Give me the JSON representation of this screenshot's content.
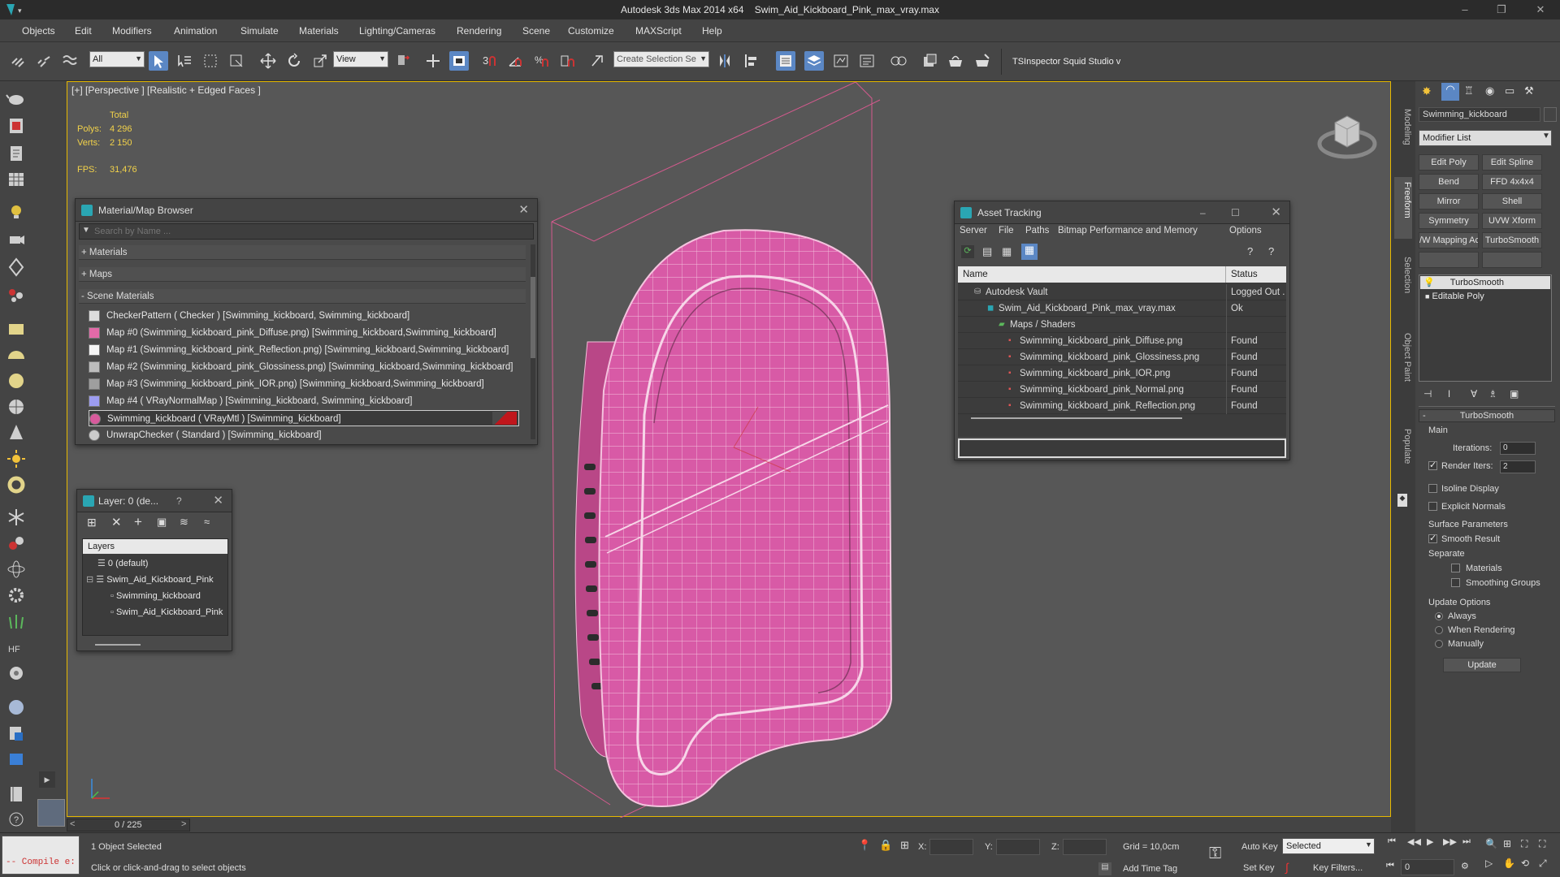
{
  "titlebar": {
    "app": "Autodesk 3ds Max  2014 x64",
    "file": "Swim_Aid_Kickboard_Pink_max_vray.max"
  },
  "menubar": {
    "items": [
      "Objects",
      "Edit",
      "Modifiers",
      "Animation",
      "Simulate",
      "Materials",
      "Lighting/Cameras",
      "Rendering",
      "Scene",
      "Customize",
      "MAXScript",
      "Help"
    ]
  },
  "toolbar": {
    "filter_value": "All",
    "ref_coord_value": "View",
    "selection_set_placeholder": "Create Selection Se",
    "ext_tools": "TSInspector  Squid Studio v"
  },
  "viewport": {
    "label": "[+] [Perspective ] [Realistic + Edged Faces ]",
    "stats_header": "Total",
    "polys_label": "Polys:",
    "polys_value": "4 296",
    "verts_label": "Verts:",
    "verts_value": "2 150",
    "fps_label": "FPS:",
    "fps_value": "31,476"
  },
  "material_browser": {
    "title": "Material/Map Browser",
    "search_placeholder": "Search by Name ...",
    "sections": [
      "+ Materials",
      "+ Maps",
      "- Scene Materials"
    ],
    "items": [
      {
        "label": "CheckerPattern  ( Checker ) [Swimming_kickboard, Swimming_kickboard]",
        "color": "#dddddd"
      },
      {
        "label": "Map #0 (Swimming_kickboard_pink_Diffuse.png) [Swimming_kickboard,Swimming_kickboard]",
        "color": "#e26aa8"
      },
      {
        "label": "Map #1 (Swimming_kickboard_pink_Reflection.png) [Swimming_kickboard,Swimming_kickboard]",
        "color": "#f5f5f5"
      },
      {
        "label": "Map #2 (Swimming_kickboard_pink_Glossiness.png) [Swimming_kickboard,Swimming_kickboard]",
        "color": "#bdbdbd"
      },
      {
        "label": "Map #3 (Swimming_kickboard_pink_IOR.png) [Swimming_kickboard,Swimming_kickboard]",
        "color": "#9e9e9e"
      },
      {
        "label": "Map #4  ( VRayNormalMap ) [Swimming_kickboard, Swimming_kickboard]",
        "color": "#9c9cf0"
      },
      {
        "label": "Swimming_kickboard  ( VRayMtl ) [Swimming_kickboard]",
        "color": "#d85a9c"
      },
      {
        "label": "UnwrapChecker  ( Standard ) [Swimming_kickboard]",
        "color": "#cccccc"
      }
    ]
  },
  "layer_panel": {
    "title": "Layer: 0 (de...",
    "help": "?",
    "header": "Layers",
    "items": [
      "0 (default)",
      "Swim_Aid_Kickboard_Pink",
      "Swimming_kickboard",
      "Swim_Aid_Kickboard_Pink"
    ]
  },
  "asset_tracking": {
    "title": "Asset Tracking",
    "menu": [
      "Server",
      "File",
      "Paths",
      "Bitmap Performance and Memory",
      "Options"
    ],
    "col_name": "Name",
    "col_status": "Status",
    "rows": [
      {
        "name": "Autodesk Vault",
        "status": "Logged Out ."
      },
      {
        "name": "Swim_Aid_Kickboard_Pink_max_vray.max",
        "status": "Ok"
      },
      {
        "name": "Maps / Shaders",
        "status": ""
      },
      {
        "name": "Swimming_kickboard_pink_Diffuse.png",
        "status": "Found"
      },
      {
        "name": "Swimming_kickboard_pink_Glossiness.png",
        "status": "Found"
      },
      {
        "name": "Swimming_kickboard_pink_IOR.png",
        "status": "Found"
      },
      {
        "name": "Swimming_kickboard_pink_Normal.png",
        "status": "Found"
      },
      {
        "name": "Swimming_kickboard_pink_Reflection.png",
        "status": "Found"
      }
    ]
  },
  "command_panel": {
    "object_name": "Swimming_kickboard",
    "modifier_list": "Modifier List",
    "mod_buttons": [
      "Edit Poly",
      "Edit Spline",
      "Bend",
      "FFD 4x4x4",
      "Mirror",
      "Shell",
      "Symmetry",
      "UVW Xform",
      "/W Mapping Ac",
      "TurboSmooth"
    ],
    "stack": [
      "TurboSmooth",
      "Editable Poly"
    ],
    "rollout_title": "TurboSmooth",
    "main_label": "Main",
    "iterations_label": "Iterations:",
    "iterations_value": "0",
    "render_iters_label": "Render Iters:",
    "render_iters_value": "2",
    "isoline_label": "Isoline Display",
    "explicit_normals_label": "Explicit Normals",
    "surface_params_label": "Surface Parameters",
    "smooth_result_label": "Smooth Result",
    "separate_label": "Separate",
    "materials_label": "Materials",
    "smoothing_groups_label": "Smoothing Groups",
    "update_options_label": "Update Options",
    "always_label": "Always",
    "when_rendering_label": "When Rendering",
    "manually_label": "Manually",
    "update_button": "Update"
  },
  "ribbon_tabs": [
    "Modeling",
    "Freeform",
    "Selection",
    "Object Paint",
    "Populate"
  ],
  "timeline": {
    "frame": "0 / 225"
  },
  "status": {
    "script_listener": "-- Compile e:",
    "selection_info": "1 Object Selected",
    "prompt": "Click or click-and-drag to select objects",
    "x_label": "X:",
    "y_label": "Y:",
    "z_label": "Z:",
    "grid": "Grid = 10,0cm",
    "add_time_tag": "Add Time Tag",
    "auto_key": "Auto Key",
    "set_key": "Set Key",
    "key_mode_value": "Selected",
    "key_filters": "Key Filters...",
    "frame_value": "0"
  }
}
